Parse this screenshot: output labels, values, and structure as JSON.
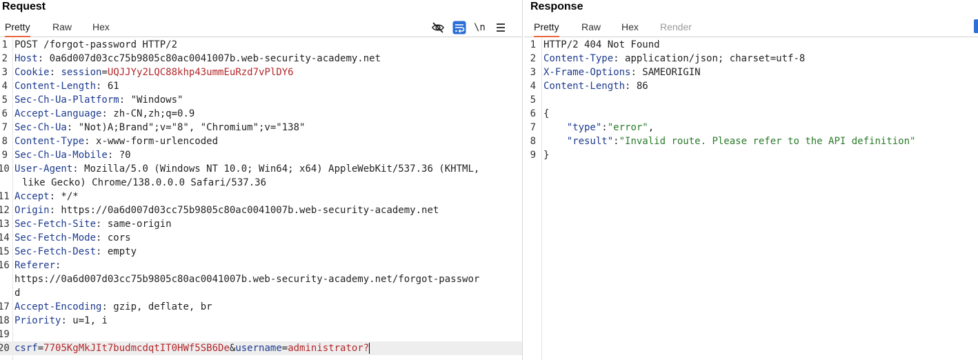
{
  "request": {
    "title": "Request",
    "tabs": [
      "Pretty",
      "Raw",
      "Hex"
    ],
    "active_tab": "Pretty",
    "icons": [
      "eye-slash-icon",
      "wrap-lines-icon",
      "newline-toggle-icon",
      "menu-icon"
    ],
    "newline_label": "\\n",
    "lines": [
      {
        "n": "1",
        "parts": [
          [
            "v",
            "POST /forgot-password HTTP/2"
          ]
        ]
      },
      {
        "n": "2",
        "parts": [
          [
            "k",
            "Host"
          ],
          [
            "v",
            ": 0a6d007d03cc75b9805c80ac0041007b.web-security-academy.net"
          ]
        ]
      },
      {
        "n": "3",
        "parts": [
          [
            "k",
            "Cookie"
          ],
          [
            "v",
            ": "
          ],
          [
            "k",
            "session"
          ],
          [
            "v",
            "="
          ],
          [
            "r",
            "UQJJYy2LQC88khp43ummEuRzd7vPlDY6"
          ]
        ]
      },
      {
        "n": "4",
        "parts": [
          [
            "k",
            "Content-Length"
          ],
          [
            "v",
            ": 61"
          ]
        ]
      },
      {
        "n": "5",
        "parts": [
          [
            "k",
            "Sec-Ch-Ua-Platform"
          ],
          [
            "v",
            ": \"Windows\""
          ]
        ]
      },
      {
        "n": "6",
        "parts": [
          [
            "k",
            "Accept-Language"
          ],
          [
            "v",
            ": zh-CN,zh;q=0.9"
          ]
        ]
      },
      {
        "n": "7",
        "parts": [
          [
            "k",
            "Sec-Ch-Ua"
          ],
          [
            "v",
            ": \"Not)A;Brand\";v=\"8\", \"Chromium\";v=\"138\""
          ]
        ]
      },
      {
        "n": "8",
        "parts": [
          [
            "k",
            "Content-Type"
          ],
          [
            "v",
            ": x-www-form-urlencoded"
          ]
        ]
      },
      {
        "n": "9",
        "parts": [
          [
            "k",
            "Sec-Ch-Ua-Mobile"
          ],
          [
            "v",
            ": ?0"
          ]
        ]
      },
      {
        "n": "10",
        "parts": [
          [
            "k",
            "User-Agent"
          ],
          [
            "v",
            ": Mozilla/5.0 (Windows NT 10.0; Win64; x64) AppleWebKit/537.36 (KHTML,"
          ]
        ],
        "cont": "like Gecko) Chrome/138.0.0.0 Safari/537.36"
      },
      {
        "n": "11",
        "parts": [
          [
            "k",
            "Accept"
          ],
          [
            "v",
            ": */*"
          ]
        ]
      },
      {
        "n": "12",
        "parts": [
          [
            "k",
            "Origin"
          ],
          [
            "v",
            ": https://0a6d007d03cc75b9805c80ac0041007b.web-security-academy.net"
          ]
        ]
      },
      {
        "n": "13",
        "parts": [
          [
            "k",
            "Sec-Fetch-Site"
          ],
          [
            "v",
            ": same-origin"
          ]
        ]
      },
      {
        "n": "14",
        "parts": [
          [
            "k",
            "Sec-Fetch-Mode"
          ],
          [
            "v",
            ": cors"
          ]
        ]
      },
      {
        "n": "15",
        "parts": [
          [
            "k",
            "Sec-Fetch-Dest"
          ],
          [
            "v",
            ": empty"
          ]
        ]
      },
      {
        "n": "16",
        "parts": [
          [
            "k",
            "Referer"
          ],
          [
            "v",
            ":"
          ]
        ],
        "cont2": "https://0a6d007d03cc75b9805c80ac0041007b.web-security-academy.net/forgot-passwor",
        "cont3": "d"
      },
      {
        "n": "17",
        "parts": [
          [
            "k",
            "Accept-Encoding"
          ],
          [
            "v",
            ": gzip, deflate, br"
          ]
        ]
      },
      {
        "n": "18",
        "parts": [
          [
            "k",
            "Priority"
          ],
          [
            "v",
            ": u=1, i"
          ]
        ]
      },
      {
        "n": "19",
        "parts": []
      },
      {
        "n": "20",
        "parts": [
          [
            "k",
            "csrf"
          ],
          [
            "v",
            "="
          ],
          [
            "r",
            "7705KgMkJIt7budmcdqtIT0HWf5SB6De"
          ],
          [
            "v",
            "&"
          ],
          [
            "k",
            "username"
          ],
          [
            "v",
            "="
          ],
          [
            "r",
            "administrator?"
          ]
        ],
        "highlight": true
      }
    ]
  },
  "response": {
    "title": "Response",
    "tabs": [
      "Pretty",
      "Raw",
      "Hex",
      "Render"
    ],
    "active_tab": "Pretty",
    "disabled_tab": "Render",
    "lines": [
      {
        "n": "1",
        "parts": [
          [
            "v",
            "HTTP/2 404 Not Found"
          ]
        ]
      },
      {
        "n": "2",
        "parts": [
          [
            "k",
            "Content-Type"
          ],
          [
            "v",
            ": application/json; charset=utf-8"
          ]
        ]
      },
      {
        "n": "3",
        "parts": [
          [
            "k",
            "X-Frame-Options"
          ],
          [
            "v",
            ": SAMEORIGIN"
          ]
        ]
      },
      {
        "n": "4",
        "parts": [
          [
            "k",
            "Content-Length"
          ],
          [
            "v",
            ": 86"
          ]
        ]
      },
      {
        "n": "5",
        "parts": []
      },
      {
        "n": "6",
        "parts": [
          [
            "v",
            "{"
          ]
        ]
      },
      {
        "n": "7",
        "parts": [
          [
            "v",
            "    "
          ],
          [
            "k",
            "\"type\""
          ],
          [
            "v",
            ":"
          ],
          [
            "g",
            "\"error\""
          ],
          [
            "v",
            ","
          ]
        ]
      },
      {
        "n": "8",
        "parts": [
          [
            "v",
            "    "
          ],
          [
            "k",
            "\"result\""
          ],
          [
            "v",
            ":"
          ],
          [
            "g",
            "\"Invalid route. Please refer to the API definition\""
          ]
        ]
      },
      {
        "n": "9",
        "parts": [
          [
            "v",
            "}"
          ]
        ]
      }
    ]
  },
  "colors": {
    "key": "#1d3a8f",
    "value": "#b4262a",
    "string": "#2a7a2a",
    "accent": "#e8663d"
  }
}
